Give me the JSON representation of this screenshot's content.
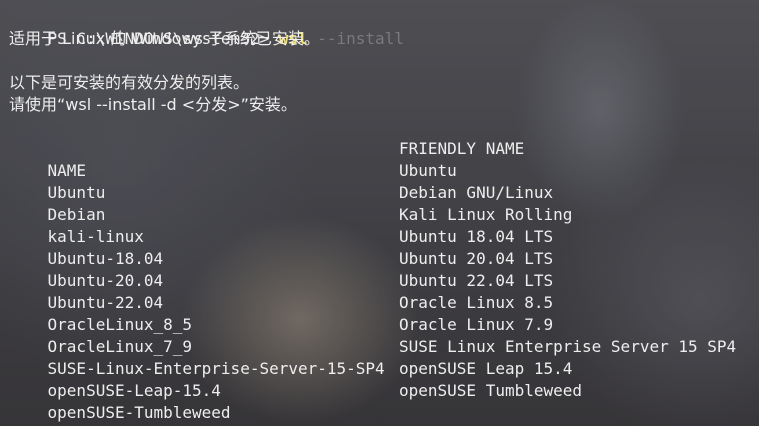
{
  "prompt": "PS C:\\WINDOWS\\system32> ",
  "command": {
    "name": "wsl",
    "suggestion": " --install"
  },
  "messages": {
    "applies_to": "适用于 Linux 的 Windows 子系统已安装。",
    "list_intro": "以下是可安装的有效分发的列表。",
    "usage": "请使用“wsl --install -d <分发>”安装。"
  },
  "table": {
    "headers": [
      "NAME",
      "FRIENDLY NAME"
    ],
    "rows": [
      [
        "Ubuntu",
        "Ubuntu"
      ],
      [
        "Debian",
        "Debian GNU/Linux"
      ],
      [
        "kali-linux",
        "Kali Linux Rolling"
      ],
      [
        "Ubuntu-18.04",
        "Ubuntu 18.04 LTS"
      ],
      [
        "Ubuntu-20.04",
        "Ubuntu 20.04 LTS"
      ],
      [
        "Ubuntu-22.04",
        "Ubuntu 22.04 LTS"
      ],
      [
        "OracleLinux_8_5",
        "Oracle Linux 8.5"
      ],
      [
        "OracleLinux_7_9",
        "Oracle Linux 7.9"
      ],
      [
        "SUSE-Linux-Enterprise-Server-15-SP4",
        "SUSE Linux Enterprise Server 15 SP4"
      ],
      [
        "openSUSE-Leap-15.4",
        "openSUSE Leap 15.4"
      ],
      [
        "openSUSE-Tumbleweed",
        "openSUSE Tumbleweed"
      ]
    ]
  },
  "colors": {
    "command": "#f5e36b",
    "suggestion": "#7a7a7a",
    "text": "#eeeeee"
  }
}
